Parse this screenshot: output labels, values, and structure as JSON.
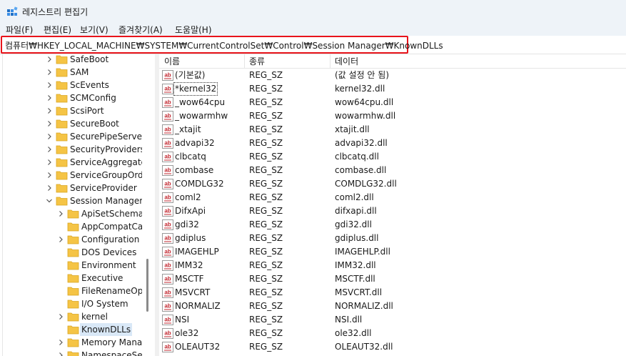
{
  "window": {
    "title": "레지스트리 편집기"
  },
  "menu": [
    "파일(F)",
    "편집(E)",
    "보기(V)",
    "즐겨찾기(A)",
    "도움말(H)"
  ],
  "address": {
    "path": "컴퓨터₩HKEY_LOCAL_MACHINE₩SYSTEM₩CurrentControlSet₩Control₩Session Manager₩KnownDLLs"
  },
  "colors": {
    "address_highlight": "#e8141b",
    "folder": "#f5c445",
    "selection": "#d9e8f7"
  },
  "tree": {
    "items": [
      {
        "label": "SafeBoot",
        "level": 1,
        "chevron": "right"
      },
      {
        "label": "SAM",
        "level": 1,
        "chevron": "right"
      },
      {
        "label": "ScEvents",
        "level": 1,
        "chevron": "right"
      },
      {
        "label": "SCMConfig",
        "level": 1,
        "chevron": "right"
      },
      {
        "label": "ScsiPort",
        "level": 1,
        "chevron": "right"
      },
      {
        "label": "SecureBoot",
        "level": 1,
        "chevron": "right"
      },
      {
        "label": "SecurePipeServers",
        "level": 1,
        "chevron": "right"
      },
      {
        "label": "SecurityProviders",
        "level": 1,
        "chevron": "right"
      },
      {
        "label": "ServiceAggregated",
        "level": 1,
        "chevron": "right"
      },
      {
        "label": "ServiceGroupOrder",
        "level": 1,
        "chevron": "right"
      },
      {
        "label": "ServiceProvider",
        "level": 1,
        "chevron": "right"
      },
      {
        "label": "Session Manager",
        "level": 1,
        "chevron": "down"
      },
      {
        "label": "ApiSetSchemaE",
        "level": 2,
        "chevron": "right"
      },
      {
        "label": "AppCompatCac",
        "level": 2,
        "chevron": "none"
      },
      {
        "label": "Configuration M",
        "level": 2,
        "chevron": "right"
      },
      {
        "label": "DOS Devices",
        "level": 2,
        "chevron": "none"
      },
      {
        "label": "Environment",
        "level": 2,
        "chevron": "none"
      },
      {
        "label": "Executive",
        "level": 2,
        "chevron": "none"
      },
      {
        "label": "FileRenameOpe",
        "level": 2,
        "chevron": "none"
      },
      {
        "label": "I/O System",
        "level": 2,
        "chevron": "none"
      },
      {
        "label": "kernel",
        "level": 2,
        "chevron": "right"
      },
      {
        "label": "KnownDLLs",
        "level": 2,
        "chevron": "none",
        "selected": true
      },
      {
        "label": "Memory Manag",
        "level": 2,
        "chevron": "right"
      },
      {
        "label": "NamespaceSepa",
        "level": 2,
        "chevron": "right"
      }
    ]
  },
  "list": {
    "columns": [
      "이름",
      "종류",
      "데이터"
    ],
    "rows": [
      {
        "name": "(기본값)",
        "type": "REG_SZ",
        "data": "(값 설정 안 됨)"
      },
      {
        "name": "*kernel32",
        "type": "REG_SZ",
        "data": "kernel32.dll",
        "focused": true
      },
      {
        "name": "_wow64cpu",
        "type": "REG_SZ",
        "data": "wow64cpu.dll"
      },
      {
        "name": "_wowarmhw",
        "type": "REG_SZ",
        "data": "wowarmhw.dll"
      },
      {
        "name": "_xtajit",
        "type": "REG_SZ",
        "data": "xtajit.dll"
      },
      {
        "name": "advapi32",
        "type": "REG_SZ",
        "data": "advapi32.dll"
      },
      {
        "name": "clbcatq",
        "type": "REG_SZ",
        "data": "clbcatq.dll"
      },
      {
        "name": "combase",
        "type": "REG_SZ",
        "data": "combase.dll"
      },
      {
        "name": "COMDLG32",
        "type": "REG_SZ",
        "data": "COMDLG32.dll"
      },
      {
        "name": "coml2",
        "type": "REG_SZ",
        "data": "coml2.dll"
      },
      {
        "name": "DifxApi",
        "type": "REG_SZ",
        "data": "difxapi.dll"
      },
      {
        "name": "gdi32",
        "type": "REG_SZ",
        "data": "gdi32.dll"
      },
      {
        "name": "gdiplus",
        "type": "REG_SZ",
        "data": "gdiplus.dll"
      },
      {
        "name": "IMAGEHLP",
        "type": "REG_SZ",
        "data": "IMAGEHLP.dll"
      },
      {
        "name": "IMM32",
        "type": "REG_SZ",
        "data": "IMM32.dll"
      },
      {
        "name": "MSCTF",
        "type": "REG_SZ",
        "data": "MSCTF.dll"
      },
      {
        "name": "MSVCRT",
        "type": "REG_SZ",
        "data": "MSVCRT.dll"
      },
      {
        "name": "NORMALIZ",
        "type": "REG_SZ",
        "data": "NORMALIZ.dll"
      },
      {
        "name": "NSI",
        "type": "REG_SZ",
        "data": "NSI.dll"
      },
      {
        "name": "ole32",
        "type": "REG_SZ",
        "data": "ole32.dll"
      },
      {
        "name": "OLEAUT32",
        "type": "REG_SZ",
        "data": "OLEAUT32.dll"
      }
    ]
  }
}
